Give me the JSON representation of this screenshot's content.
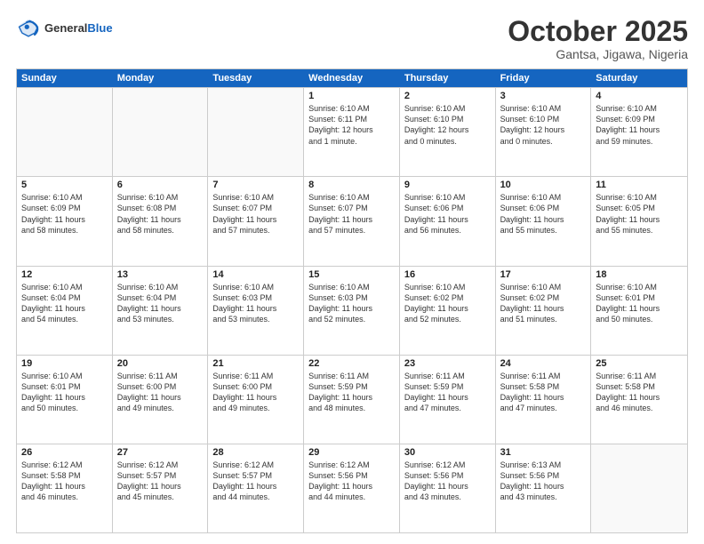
{
  "header": {
    "logo_general": "General",
    "logo_blue": "Blue",
    "month": "October 2025",
    "location": "Gantsa, Jigawa, Nigeria"
  },
  "weekdays": [
    "Sunday",
    "Monday",
    "Tuesday",
    "Wednesday",
    "Thursday",
    "Friday",
    "Saturday"
  ],
  "rows": [
    [
      {
        "day": "",
        "info": ""
      },
      {
        "day": "",
        "info": ""
      },
      {
        "day": "",
        "info": ""
      },
      {
        "day": "1",
        "info": "Sunrise: 6:10 AM\nSunset: 6:11 PM\nDaylight: 12 hours\nand 1 minute."
      },
      {
        "day": "2",
        "info": "Sunrise: 6:10 AM\nSunset: 6:10 PM\nDaylight: 12 hours\nand 0 minutes."
      },
      {
        "day": "3",
        "info": "Sunrise: 6:10 AM\nSunset: 6:10 PM\nDaylight: 12 hours\nand 0 minutes."
      },
      {
        "day": "4",
        "info": "Sunrise: 6:10 AM\nSunset: 6:09 PM\nDaylight: 11 hours\nand 59 minutes."
      }
    ],
    [
      {
        "day": "5",
        "info": "Sunrise: 6:10 AM\nSunset: 6:09 PM\nDaylight: 11 hours\nand 58 minutes."
      },
      {
        "day": "6",
        "info": "Sunrise: 6:10 AM\nSunset: 6:08 PM\nDaylight: 11 hours\nand 58 minutes."
      },
      {
        "day": "7",
        "info": "Sunrise: 6:10 AM\nSunset: 6:07 PM\nDaylight: 11 hours\nand 57 minutes."
      },
      {
        "day": "8",
        "info": "Sunrise: 6:10 AM\nSunset: 6:07 PM\nDaylight: 11 hours\nand 57 minutes."
      },
      {
        "day": "9",
        "info": "Sunrise: 6:10 AM\nSunset: 6:06 PM\nDaylight: 11 hours\nand 56 minutes."
      },
      {
        "day": "10",
        "info": "Sunrise: 6:10 AM\nSunset: 6:06 PM\nDaylight: 11 hours\nand 55 minutes."
      },
      {
        "day": "11",
        "info": "Sunrise: 6:10 AM\nSunset: 6:05 PM\nDaylight: 11 hours\nand 55 minutes."
      }
    ],
    [
      {
        "day": "12",
        "info": "Sunrise: 6:10 AM\nSunset: 6:04 PM\nDaylight: 11 hours\nand 54 minutes."
      },
      {
        "day": "13",
        "info": "Sunrise: 6:10 AM\nSunset: 6:04 PM\nDaylight: 11 hours\nand 53 minutes."
      },
      {
        "day": "14",
        "info": "Sunrise: 6:10 AM\nSunset: 6:03 PM\nDaylight: 11 hours\nand 53 minutes."
      },
      {
        "day": "15",
        "info": "Sunrise: 6:10 AM\nSunset: 6:03 PM\nDaylight: 11 hours\nand 52 minutes."
      },
      {
        "day": "16",
        "info": "Sunrise: 6:10 AM\nSunset: 6:02 PM\nDaylight: 11 hours\nand 52 minutes."
      },
      {
        "day": "17",
        "info": "Sunrise: 6:10 AM\nSunset: 6:02 PM\nDaylight: 11 hours\nand 51 minutes."
      },
      {
        "day": "18",
        "info": "Sunrise: 6:10 AM\nSunset: 6:01 PM\nDaylight: 11 hours\nand 50 minutes."
      }
    ],
    [
      {
        "day": "19",
        "info": "Sunrise: 6:10 AM\nSunset: 6:01 PM\nDaylight: 11 hours\nand 50 minutes."
      },
      {
        "day": "20",
        "info": "Sunrise: 6:11 AM\nSunset: 6:00 PM\nDaylight: 11 hours\nand 49 minutes."
      },
      {
        "day": "21",
        "info": "Sunrise: 6:11 AM\nSunset: 6:00 PM\nDaylight: 11 hours\nand 49 minutes."
      },
      {
        "day": "22",
        "info": "Sunrise: 6:11 AM\nSunset: 5:59 PM\nDaylight: 11 hours\nand 48 minutes."
      },
      {
        "day": "23",
        "info": "Sunrise: 6:11 AM\nSunset: 5:59 PM\nDaylight: 11 hours\nand 47 minutes."
      },
      {
        "day": "24",
        "info": "Sunrise: 6:11 AM\nSunset: 5:58 PM\nDaylight: 11 hours\nand 47 minutes."
      },
      {
        "day": "25",
        "info": "Sunrise: 6:11 AM\nSunset: 5:58 PM\nDaylight: 11 hours\nand 46 minutes."
      }
    ],
    [
      {
        "day": "26",
        "info": "Sunrise: 6:12 AM\nSunset: 5:58 PM\nDaylight: 11 hours\nand 46 minutes."
      },
      {
        "day": "27",
        "info": "Sunrise: 6:12 AM\nSunset: 5:57 PM\nDaylight: 11 hours\nand 45 minutes."
      },
      {
        "day": "28",
        "info": "Sunrise: 6:12 AM\nSunset: 5:57 PM\nDaylight: 11 hours\nand 44 minutes."
      },
      {
        "day": "29",
        "info": "Sunrise: 6:12 AM\nSunset: 5:56 PM\nDaylight: 11 hours\nand 44 minutes."
      },
      {
        "day": "30",
        "info": "Sunrise: 6:12 AM\nSunset: 5:56 PM\nDaylight: 11 hours\nand 43 minutes."
      },
      {
        "day": "31",
        "info": "Sunrise: 6:13 AM\nSunset: 5:56 PM\nDaylight: 11 hours\nand 43 minutes."
      },
      {
        "day": "",
        "info": ""
      }
    ]
  ]
}
